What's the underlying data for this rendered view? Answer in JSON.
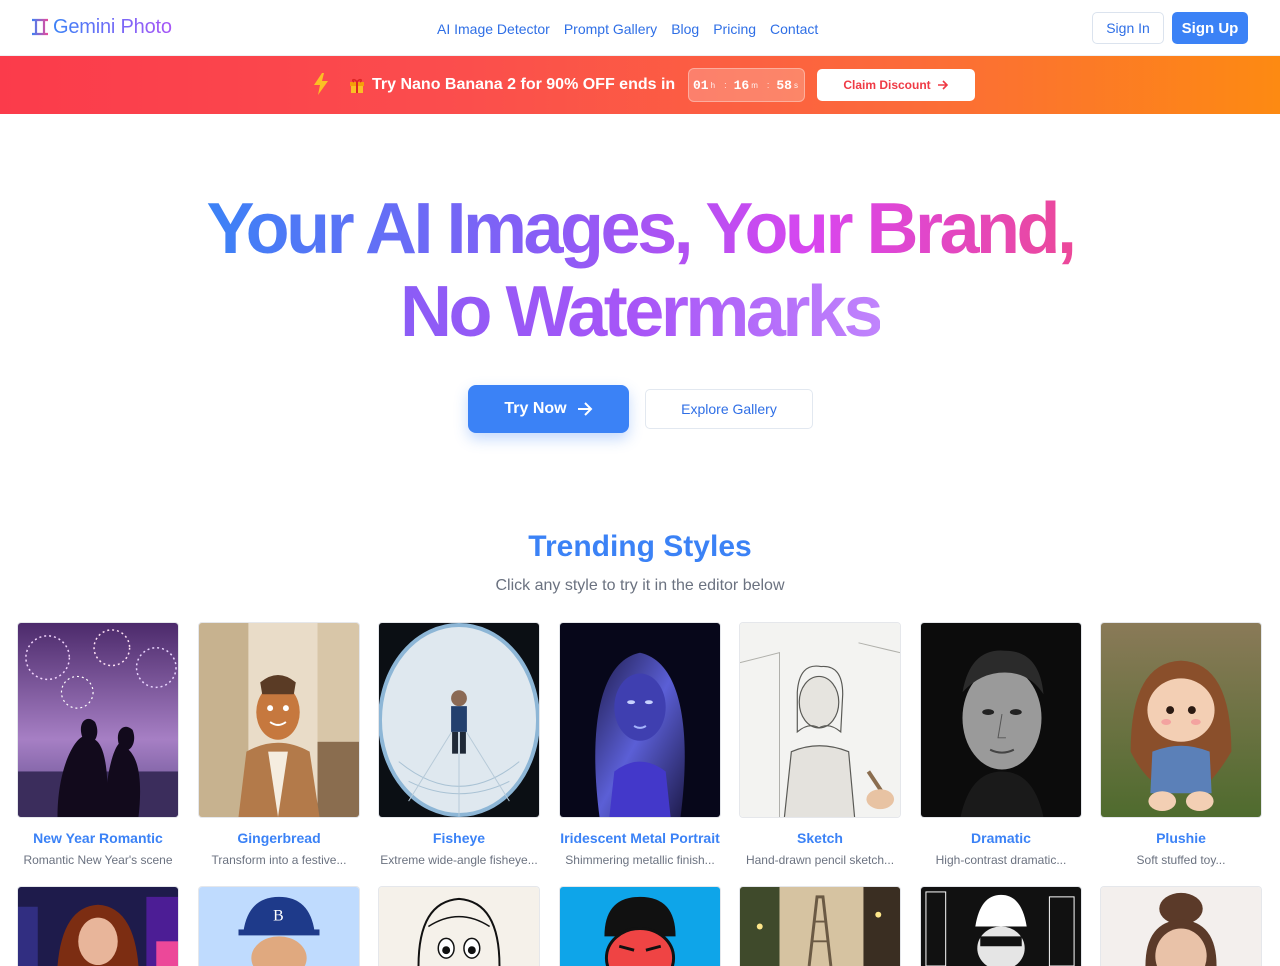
{
  "nav": {
    "brand": "Gemini Photo",
    "links": [
      "AI Image Detector",
      "Prompt Gallery",
      "Blog",
      "Pricing",
      "Contact"
    ],
    "sign_in": "Sign In",
    "sign_up": "Sign Up"
  },
  "promo": {
    "emoji": "🎁",
    "text": "Try Nano Banana 2 for 90% OFF ends in",
    "countdown": {
      "hours": "01",
      "hours_unit": "h",
      "minutes": "16",
      "minutes_unit": "m",
      "seconds": "58",
      "seconds_unit": "s",
      "separator": ":"
    },
    "claim_label": "Claim Discount"
  },
  "hero": {
    "line1": "Your AI Images, Your Brand,",
    "line2": "No Watermarks",
    "try_now": "Try Now",
    "explore": "Explore Gallery"
  },
  "trending": {
    "title": "Trending Styles",
    "subtitle": "Click any style to try it in the editor below",
    "styles": [
      {
        "title": "New Year Romantic",
        "desc": "Romantic New Year's scene"
      },
      {
        "title": "Gingerbread",
        "desc": "Transform into a festive..."
      },
      {
        "title": "Fisheye",
        "desc": "Extreme wide-angle fisheye..."
      },
      {
        "title": "Iridescent Metal Portrait",
        "desc": "Shimmering metallic finish..."
      },
      {
        "title": "Sketch",
        "desc": "Hand-drawn pencil sketch..."
      },
      {
        "title": "Dramatic",
        "desc": "High-contrast dramatic..."
      },
      {
        "title": "Plushie",
        "desc": "Soft stuffed toy..."
      }
    ]
  },
  "colors": {
    "accent": "#3b82f6",
    "promo_start": "#fb3b4b",
    "promo_end": "#fd8a12"
  }
}
